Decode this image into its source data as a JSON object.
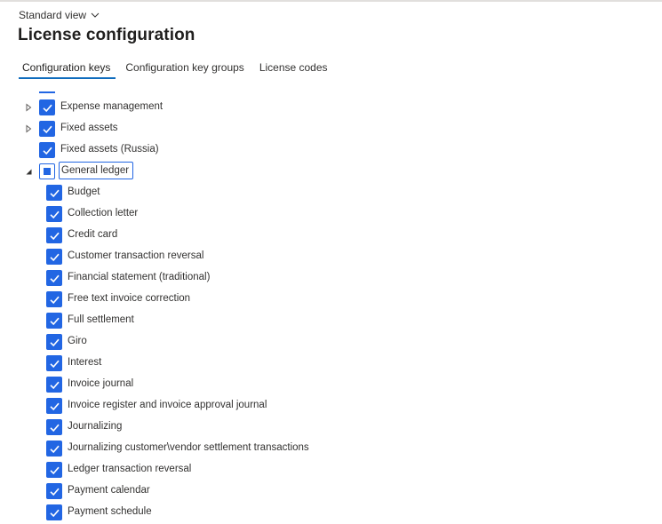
{
  "header": {
    "view_label": "Standard view",
    "title": "License configuration"
  },
  "tabs": [
    {
      "label": "Configuration keys",
      "active": true
    },
    {
      "label": "Configuration key groups",
      "active": false
    },
    {
      "label": "License codes",
      "active": false
    }
  ],
  "tree": {
    "top_items": [
      {
        "label": "Expense management",
        "expander": "collapsed",
        "checked": true
      },
      {
        "label": "Fixed assets",
        "expander": "collapsed",
        "checked": true
      },
      {
        "label": "Fixed assets (Russia)",
        "expander": "none",
        "checked": true
      },
      {
        "label": "General ledger",
        "expander": "expanded",
        "checked": "partial"
      }
    ],
    "children": [
      {
        "label": "Budget",
        "checked": true
      },
      {
        "label": "Collection letter",
        "checked": true
      },
      {
        "label": "Credit card",
        "checked": true
      },
      {
        "label": "Customer transaction reversal",
        "checked": true
      },
      {
        "label": "Financial statement (traditional)",
        "checked": true
      },
      {
        "label": "Free text invoice correction",
        "checked": true
      },
      {
        "label": "Full settlement",
        "checked": true
      },
      {
        "label": "Giro",
        "checked": true
      },
      {
        "label": "Interest",
        "checked": true
      },
      {
        "label": "Invoice journal",
        "checked": true
      },
      {
        "label": "Invoice register and invoice approval journal",
        "checked": true
      },
      {
        "label": "Journalizing",
        "checked": true
      },
      {
        "label": "Journalizing customer\\vendor settlement transactions",
        "checked": true
      },
      {
        "label": "Ledger transaction reversal",
        "checked": true
      },
      {
        "label": "Payment calendar",
        "checked": true
      },
      {
        "label": "Payment schedule",
        "checked": true
      }
    ]
  },
  "colors": {
    "accent": "#2266e3",
    "tab_underline": "#0f6cbd"
  }
}
